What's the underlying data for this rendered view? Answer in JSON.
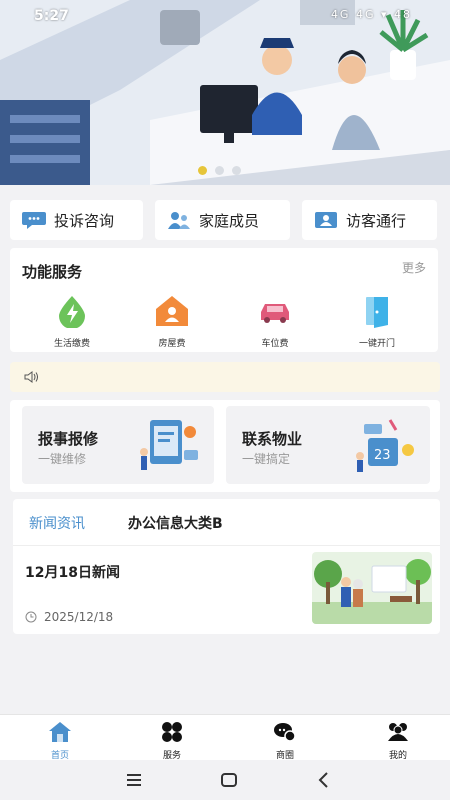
{
  "status_bar": {
    "time": "5:27",
    "indicators": "4G 4G ▾ 48"
  },
  "banner": {
    "page_dots": 3,
    "active_dot": 0
  },
  "quick_actions": [
    {
      "label": "投诉咨询",
      "icon": "chat-icon"
    },
    {
      "label": "家庭成员",
      "icon": "family-icon"
    },
    {
      "label": "访客通行",
      "icon": "visitor-id-icon"
    }
  ],
  "services": {
    "title": "功能服务",
    "more_label": "更多",
    "items": [
      {
        "label": "生活缴费",
        "icon": "utility-bolt-icon",
        "color": "#5fbf4a"
      },
      {
        "label": "房屋费",
        "icon": "house-icon",
        "color": "#f28a3a"
      },
      {
        "label": "车位费",
        "icon": "car-icon",
        "color": "#e05a7a"
      },
      {
        "label": "一键开门",
        "icon": "door-icon",
        "color": "#3fb2e8"
      }
    ]
  },
  "notice": {
    "icon": "speaker-icon"
  },
  "cards": [
    {
      "title": "报事报修",
      "subtitle": "一键维修"
    },
    {
      "title": "联系物业",
      "subtitle": "一键搞定"
    }
  ],
  "news": {
    "tabs": [
      "新闻资讯",
      "办公信息大类B"
    ],
    "active_tab": 0,
    "items": [
      {
        "title": "12月18日新闻",
        "date": "2025/12/18"
      }
    ]
  },
  "tabbar": [
    {
      "label": "首页",
      "icon": "home-icon",
      "active": true
    },
    {
      "label": "服务",
      "icon": "clover-icon",
      "active": false
    },
    {
      "label": "商圈",
      "icon": "chat-bubbles-icon",
      "active": false
    },
    {
      "label": "我的",
      "icon": "users-icon",
      "active": false
    }
  ],
  "colors": {
    "accent": "#4a8fcc",
    "notice_bg": "#fbf6e6",
    "page_bg": "#f2f2f4"
  }
}
